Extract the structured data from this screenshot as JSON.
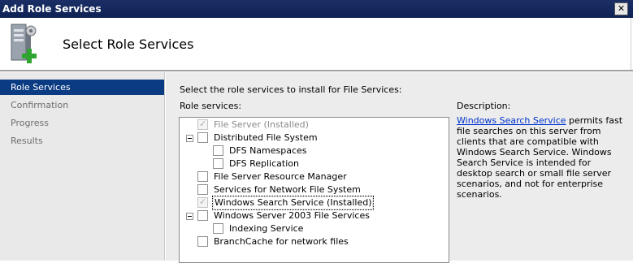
{
  "window": {
    "title": "Add Role Services",
    "close_glyph": "✕"
  },
  "header": {
    "title": "Select Role Services",
    "icon": "server-add-icon"
  },
  "sidebar": {
    "items": [
      {
        "label": "Role Services",
        "active": true
      },
      {
        "label": "Confirmation",
        "active": false
      },
      {
        "label": "Progress",
        "active": false
      },
      {
        "label": "Results",
        "active": false
      }
    ]
  },
  "main": {
    "instructions": "Select the role services to install for File Services:",
    "role_services_label": "Role services:",
    "description_label": "Description:",
    "tree": [
      {
        "label": "File Server  (Installed)",
        "checked": true,
        "disabled": true
      },
      {
        "label": "Distributed File System",
        "checked": false,
        "expander": true
      },
      {
        "label": "DFS Namespaces",
        "checked": false
      },
      {
        "label": "DFS Replication",
        "checked": false
      },
      {
        "label": "File Server Resource Manager",
        "checked": false
      },
      {
        "label": "Services for Network File System",
        "checked": false
      },
      {
        "label": "Windows Search Service  (Installed)",
        "checked": true,
        "selected": true
      },
      {
        "label": "Windows Server 2003 File Services",
        "checked": false,
        "expander": true
      },
      {
        "label": "Indexing Service",
        "checked": false
      },
      {
        "label": "BranchCache for network files",
        "checked": false
      }
    ],
    "description": {
      "link": "Windows Search Service",
      "text": " permits fast file searches on this server from clients that are compatible with Windows Search Service. Windows Search Service is intended for desktop search or small file server scenarios, and not for enterprise scenarios."
    }
  },
  "colors": {
    "titlebar": "#0e2255",
    "nav_active": "#0b3b83",
    "link": "#0033cc"
  }
}
